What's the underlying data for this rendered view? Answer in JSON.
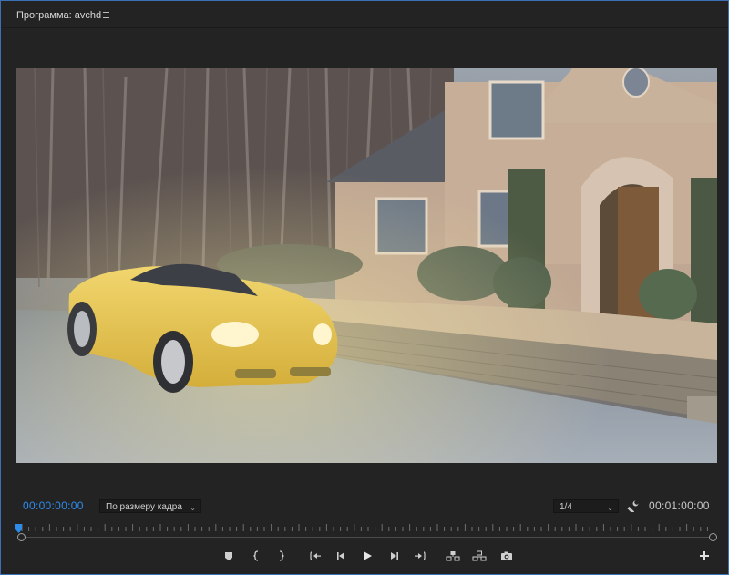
{
  "panel": {
    "title": "Программа: avchd",
    "menu_icon": "hamburger-icon"
  },
  "video": {
    "description_icon": "video-frame"
  },
  "playback": {
    "current_timecode": "00:00:00:00",
    "duration_timecode": "00:01:00:00",
    "zoom_value": "По размеру кадра",
    "resolution_value": "1/4",
    "position_fraction": 0
  },
  "controls": [
    {
      "name": "add-marker-button",
      "icon": "marker-icon"
    },
    {
      "name": "mark-in-button",
      "icon": "mark-in-icon"
    },
    {
      "name": "mark-out-button",
      "icon": "mark-out-icon"
    },
    {
      "name": "go-to-in-button",
      "icon": "go-to-in-icon"
    },
    {
      "name": "step-back-button",
      "icon": "step-back-icon"
    },
    {
      "name": "play-button",
      "icon": "play-icon"
    },
    {
      "name": "step-forward-button",
      "icon": "step-forward-icon"
    },
    {
      "name": "go-to-out-button",
      "icon": "go-to-out-icon"
    },
    {
      "name": "lift-button",
      "icon": "lift-icon"
    },
    {
      "name": "extract-button",
      "icon": "extract-icon"
    },
    {
      "name": "export-frame-button",
      "icon": "camera-icon"
    },
    {
      "name": "button-editor-button",
      "icon": "plus-icon"
    }
  ],
  "colors": {
    "accent": "#2d8ceb",
    "panel_border": "#3b6fb6",
    "background": "#232323"
  }
}
